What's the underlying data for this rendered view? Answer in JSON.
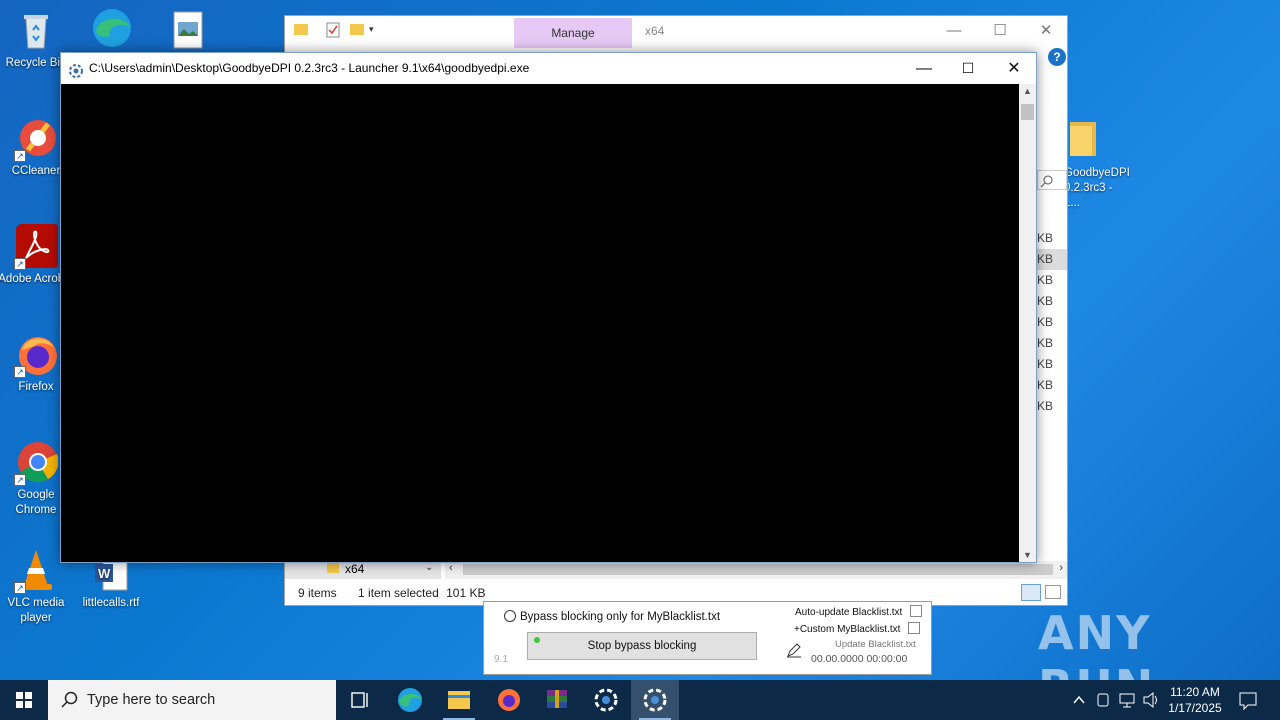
{
  "desktop": {
    "icons": [
      {
        "label": "Recycle Bin"
      },
      {
        "label": "CCleaner"
      },
      {
        "label": "Adobe Acrobat"
      },
      {
        "label": "Firefox"
      },
      {
        "label": "Google Chrome"
      },
      {
        "label": "VLC media player"
      },
      {
        "label": "littlecalls.rtf"
      },
      {
        "label": "GoodbyeDPI 0.2.3rc3 - L..."
      }
    ],
    "watermark": "ANY RUN"
  },
  "explorer": {
    "manage_tab": "Manage",
    "title": "x64",
    "sizes": [
      "KB",
      "KB",
      "KB",
      "KB",
      "KB",
      "KB",
      "KB",
      "KB",
      "KB"
    ],
    "nav_item": "x64",
    "status_items": "9 items",
    "status_selected": "1 item selected",
    "status_size": "101 KB"
  },
  "console": {
    "title": "C:\\Users\\admin\\Desktop\\GoodbyeDPI 0.2.3rc3 - Launcher 9.1\\x64\\goodbyedpi.exe"
  },
  "launcher": {
    "radio_label": "Bypass blocking only for MyBlacklist.txt",
    "auto_update_label": "Auto-update Blacklist.txt",
    "custom_label": "+Custom MyBlacklist.txt",
    "update_label": "Update Blacklist.txt",
    "stop_button": "Stop bypass blocking",
    "version": "9.1",
    "timestamp": "00.00.0000 00:00:00"
  },
  "taskbar": {
    "search_placeholder": "Type here to search",
    "time": "11:20 AM",
    "date": "1/17/2025"
  }
}
